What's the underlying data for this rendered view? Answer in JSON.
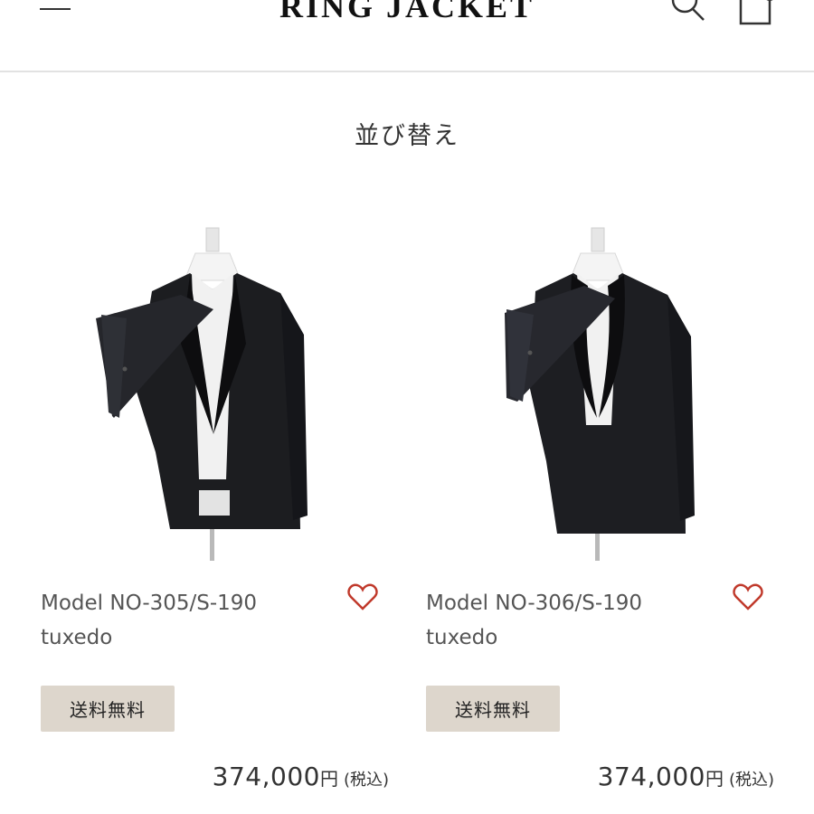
{
  "header": {
    "logo": "RING JACKET"
  },
  "sort": {
    "label": "並び替え"
  },
  "products": [
    {
      "name_line1": "Model NO-305/S-190",
      "name_line2": "tuxedo",
      "badge": "送料無料",
      "price": "374,000",
      "currency": "円",
      "tax": "(税込)"
    },
    {
      "name_line1": "Model NO-306/S-190",
      "name_line2": "tuxedo",
      "badge": "送料無料",
      "price": "374,000",
      "currency": "円",
      "tax": "(税込)"
    }
  ],
  "colors": {
    "accent": "#c0392b",
    "badge_bg": "#ddd6cc",
    "divider": "#e2e2e2"
  },
  "icons": {
    "menu": "menu-icon",
    "search": "search-icon",
    "cart": "cart-icon",
    "favorite": "heart-icon"
  }
}
